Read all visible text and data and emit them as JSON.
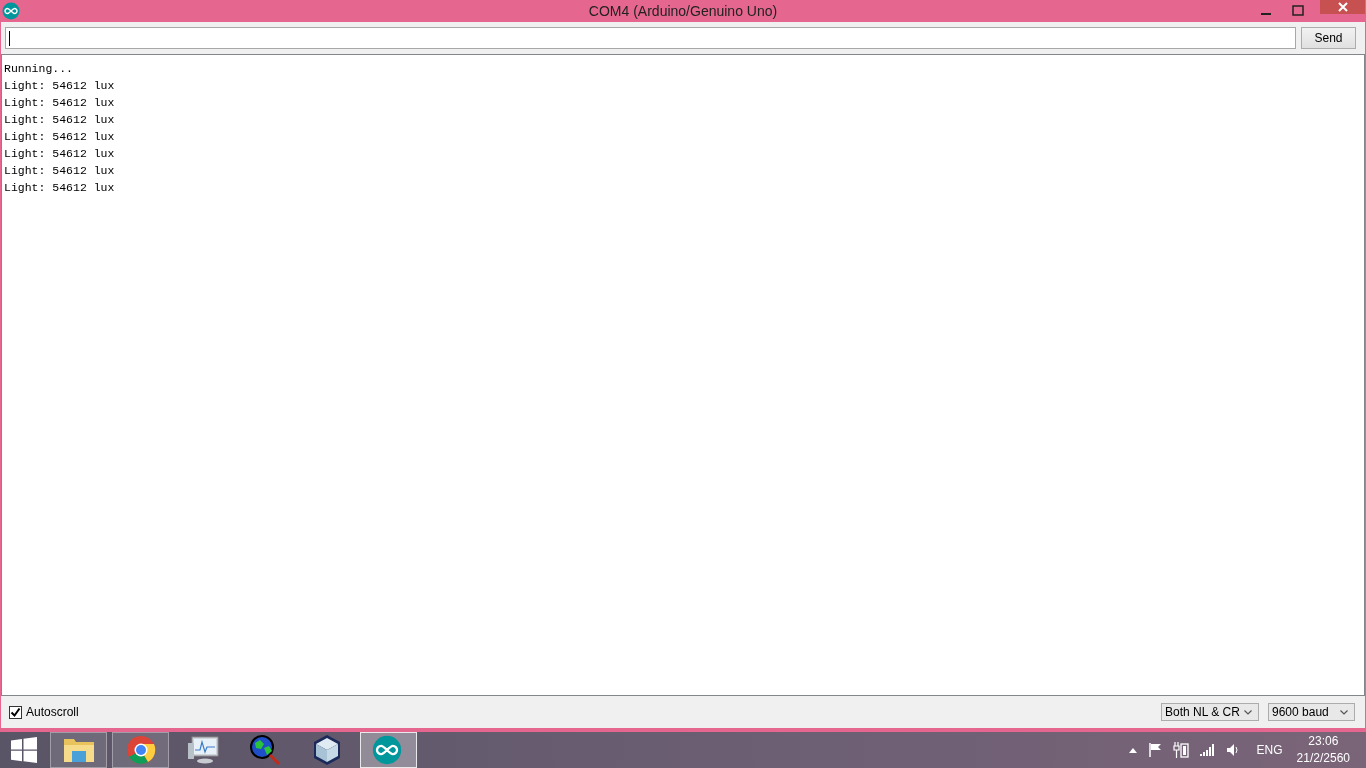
{
  "window": {
    "title": "COM4 (Arduino/Genuino Uno)"
  },
  "send_button": "Send",
  "output_lines": [
    "Running...",
    "Light: 54612 lux",
    "Light: 54612 lux",
    "Light: 54612 lux",
    "Light: 54612 lux",
    "Light: 54612 lux",
    "Light: 54612 lux",
    "Light: 54612 lux"
  ],
  "autoscroll": {
    "label": "Autoscroll",
    "checked": true
  },
  "line_ending": "Both NL & CR",
  "baud_rate": "9600 baud",
  "taskbar": {
    "apps": [
      {
        "kind": "folder",
        "running": true,
        "selected": false
      },
      {
        "kind": "browser",
        "running": true,
        "selected": false
      },
      {
        "kind": "monitor",
        "running": false,
        "selected": false
      },
      {
        "kind": "globe",
        "running": false,
        "selected": false
      },
      {
        "kind": "cube",
        "running": false,
        "selected": false
      },
      {
        "kind": "arduino",
        "running": true,
        "selected": true
      }
    ],
    "language": "ENG",
    "time": "23:06",
    "date": "21/2/2560"
  }
}
